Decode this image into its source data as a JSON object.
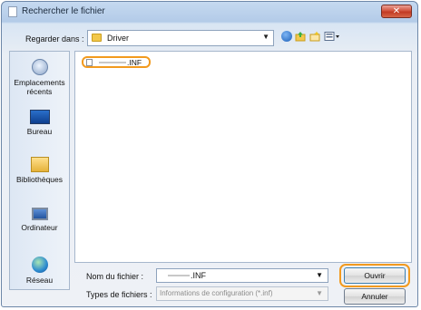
{
  "window": {
    "title": "Rechercher le fichier",
    "close_glyph": "✕"
  },
  "toolbar": {
    "look_in_label": "Regarder dans :",
    "look_in_value": "Driver",
    "icons": [
      "back-icon",
      "up-folder-icon",
      "new-folder-icon",
      "view-menu-icon"
    ]
  },
  "places": [
    {
      "label": "Emplacements récents",
      "icon": "recent-places-icon"
    },
    {
      "label": "Bureau",
      "icon": "desktop-icon"
    },
    {
      "label": "Bibliothèques",
      "icon": "libraries-icon"
    },
    {
      "label": "Ordinateur",
      "icon": "computer-icon"
    },
    {
      "label": "Réseau",
      "icon": "network-icon"
    }
  ],
  "files": [
    {
      "ext": ".INF",
      "selected": true
    }
  ],
  "form": {
    "filename_label": "Nom du fichier :",
    "filename_ext": ".INF",
    "filetype_label": "Types de fichiers :",
    "filetype_value": "Informations de configuration (*.inf)"
  },
  "buttons": {
    "open": "Ouvrir",
    "cancel": "Annuler"
  },
  "colors": {
    "highlight": "#f29a1e",
    "title_bar": "#b3cbe8",
    "close_button": "#c23a23"
  }
}
